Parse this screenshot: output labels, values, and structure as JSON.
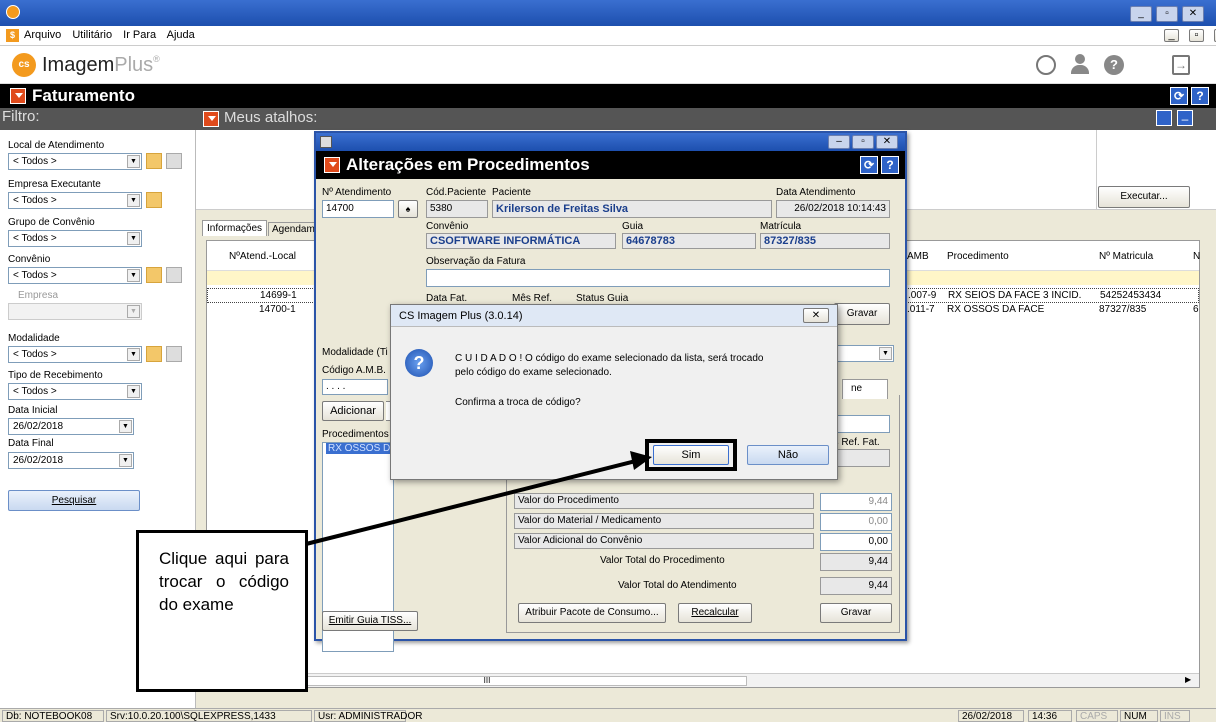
{
  "window": {
    "title": "",
    "controls": [
      "_",
      "▫",
      "✕"
    ]
  },
  "menu": {
    "items": [
      "Arquivo",
      "Utilitário",
      "Ir Para",
      "Ajuda"
    ],
    "mdi_controls": [
      "_",
      "▫",
      "x"
    ]
  },
  "app": {
    "brand": "Imagem",
    "brand2": "Plus"
  },
  "faturamento": {
    "title": "Faturamento"
  },
  "filter": {
    "title": "Filtro:",
    "local_label": "Local de Atendimento",
    "local_value": "< Todos >",
    "empresa_exec_label": "Empresa Executante",
    "empresa_exec_value": "< Todos >",
    "grupo_label": "Grupo de Convênio",
    "grupo_value": "< Todos >",
    "convenio_label": "Convênio",
    "convenio_value": "< Todos >",
    "empresa_label": "Empresa",
    "modalidade_label": "Modalidade",
    "modalidade_value": "< Todos >",
    "tipo_label": "Tipo de Recebimento",
    "tipo_value": "< Todos >",
    "data_inicial_label": "Data Inicial",
    "data_inicial_value": "26/02/2018",
    "data_final_label": "Data Final",
    "data_final_value": "26/02/2018",
    "pesquisar": "Pesquisar"
  },
  "atalhos": {
    "title": "Meus atalhos:",
    "executar": "Executar..."
  },
  "grid": {
    "tabs": [
      "Informações",
      "Agendam"
    ],
    "col_natend": "NºAtend.-Local",
    "col_amb": "AMB",
    "col_proc": "Procedimento",
    "col_matr": "Nº Matricula",
    "col_n": "N",
    "rows": [
      {
        "natend": "14699-1",
        "amb": ".007-9",
        "proc": "RX SEIOS DA FACE 3 INCID.",
        "matr": "54252453434",
        "n": ""
      },
      {
        "natend": "14700-1",
        "amb": ".011-7",
        "proc": "RX OSSOS DA FACE",
        "matr": "87327/835",
        "n": "6"
      }
    ],
    "scroll_mid": "III"
  },
  "dialog": {
    "title": "Alterações em Procedimentos",
    "natend_label": "Nº Atendimento",
    "natend_value": "14700",
    "codpac_label": "Cód.Paciente",
    "codpac_value": "5380",
    "paciente_label": "Paciente",
    "paciente_value": "Krilerson de Freitas Silva",
    "data_atend_label": "Data Atendimento",
    "data_atend_value": "26/02/2018 10:14:43",
    "convenio_label": "Convênio",
    "convenio_value": "CSOFTWARE INFORMÁTICA",
    "guia_label": "Guia",
    "guia_value": "64678783",
    "matricula_label": "Matrícula",
    "matricula_value": "87327/835",
    "obs_label": "Observação da Fatura",
    "datafat_label": "Data Fat.",
    "mesref_label": "Mês Ref.",
    "statusguia_label": "Status Guia",
    "gravar_top": "Gravar",
    "modalidade_label": "Modalidade (Ti",
    "codamb_label": "Código A.M.B.",
    "codamb_value": ". . . .",
    "adicionar": "Adicionar",
    "procedimentos_label": "Procedimentos",
    "proc_item": "RX OSSOS D.",
    "tab_right": "ne",
    "ref_fat_label": "es Ref. Fat.",
    "valor_proc_label": "Valor do Procedimento",
    "valor_proc": "9,44",
    "valor_mat_label": "Valor do Material / Medicamento",
    "valor_mat": "0,00",
    "valor_adic_label": "Valor Adicional do Convênio",
    "valor_adic": "0,00",
    "total_proc_label": "Valor Total do Procedimento",
    "total_proc": "9,44",
    "total_atend_label": "Valor Total do Atendimento",
    "total_atend": "9,44",
    "atribuir": "Atribuir Pacote de Consumo...",
    "recalcular": "Recalcular",
    "gravar": "Gravar",
    "emitir": "Emitir Guia TISS..."
  },
  "msgbox": {
    "title": "CS Imagem Plus (3.0.14)",
    "line1": "C U I D A D O !  O código do exame selecionado da lista, será trocado",
    "line2": "pelo código do exame selecionado.",
    "question": "Confirma a troca de código?",
    "sim": "Sim",
    "nao": "Não",
    "close": "✕"
  },
  "callout": {
    "text": "Clique aqui para trocar o código do exame"
  },
  "status": {
    "db": "Db: NOTEBOOK08",
    "srv": "Srv:10.0.20.100\\SQLEXPRESS,1433",
    "usr": "Usr: ADMINISTRADOR",
    "date": "26/02/2018",
    "time": "14:36",
    "caps": "CAPS",
    "num": "NUM",
    "ins": "INS"
  },
  "colors": {
    "accent": "#2f63c8",
    "brand": "#f39a1e"
  }
}
